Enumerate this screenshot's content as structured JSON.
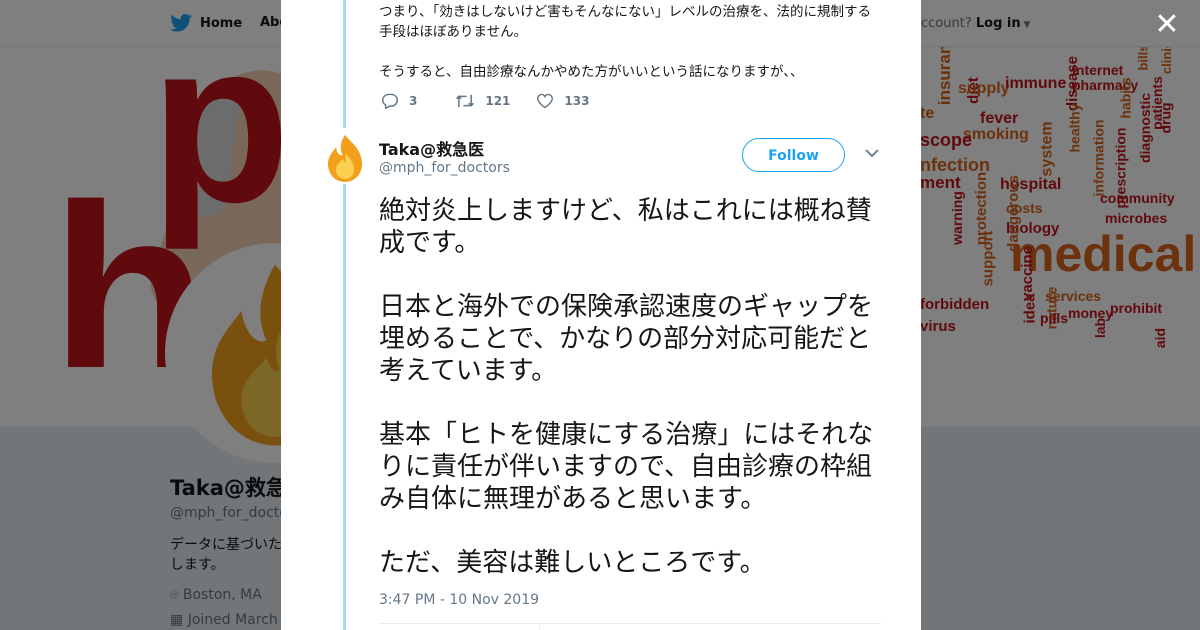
{
  "nav": {
    "home": "Home",
    "about": "Abo",
    "account_prefix": "ccount?",
    "login": "Log in"
  },
  "profile_bg": {
    "name": "Taka@救急",
    "handle": "@mph_for_docto",
    "bio": "データに基づいた\nします。",
    "location": "Boston, MA",
    "joined": "Joined March"
  },
  "banner": {
    "letters": [
      "p",
      "h"
    ],
    "words": [
      "insurance",
      "diet",
      "supply",
      "immune",
      "internet",
      "pharmacy",
      "bills",
      "te",
      "fever",
      "smoking",
      "disease",
      "healthy",
      "habits",
      "patients",
      "clinic",
      "scope",
      "system",
      "diagnostic",
      "drug",
      "nfection",
      "hospital",
      "information",
      "prescription",
      "ment",
      "community",
      "costs",
      "biology",
      "microbes",
      "warning",
      "protection",
      "dangerous",
      "support",
      "medical",
      "vaccine",
      "idea",
      "nature",
      "services",
      "pills",
      "money",
      "prohibit",
      "forbidden",
      "virus",
      "lab",
      "aid"
    ],
    "accent_red": "#c2141b",
    "accent_orange": "#d9641c"
  },
  "previous_tweet": {
    "text": "つまり、「効きはしないけど害もそんなにない」レベルの治療を、法的に規制する手段はほぼありません。\n\nそうすると、自由診療なんかやめた方がいいという話になりますが、、",
    "replies": "3",
    "retweets": "121",
    "likes": "133"
  },
  "tweet": {
    "author_name": "Taka@救急医",
    "author_handle": "@mph_for_doctors",
    "follow_label": "Follow",
    "paragraphs": [
      "絶対炎上しますけど、私はこれには概ね賛成です。",
      "日本と海外での保険承認速度のギャップを埋めることで、かなりの部分対応可能だと考えています。",
      "基本「ヒトを健康にする治療」にはそれなりに責任が伴いますので、自由診療の枠組み自体に無理があると思います。",
      "ただ、美容は難しいところです。"
    ],
    "timestamp": "3:47 PM - 10 Nov 2019"
  },
  "colors": {
    "twitter_blue": "#1da1f2",
    "thread_line": "#aad8f3",
    "secondary_text": "#657786"
  },
  "icons": {
    "brand": "twitter-bird-icon",
    "close": "close-icon",
    "reply": "reply-icon",
    "retweet": "retweet-icon",
    "like": "heart-icon",
    "more": "chevron-down-icon",
    "avatar": "fire-icon"
  }
}
